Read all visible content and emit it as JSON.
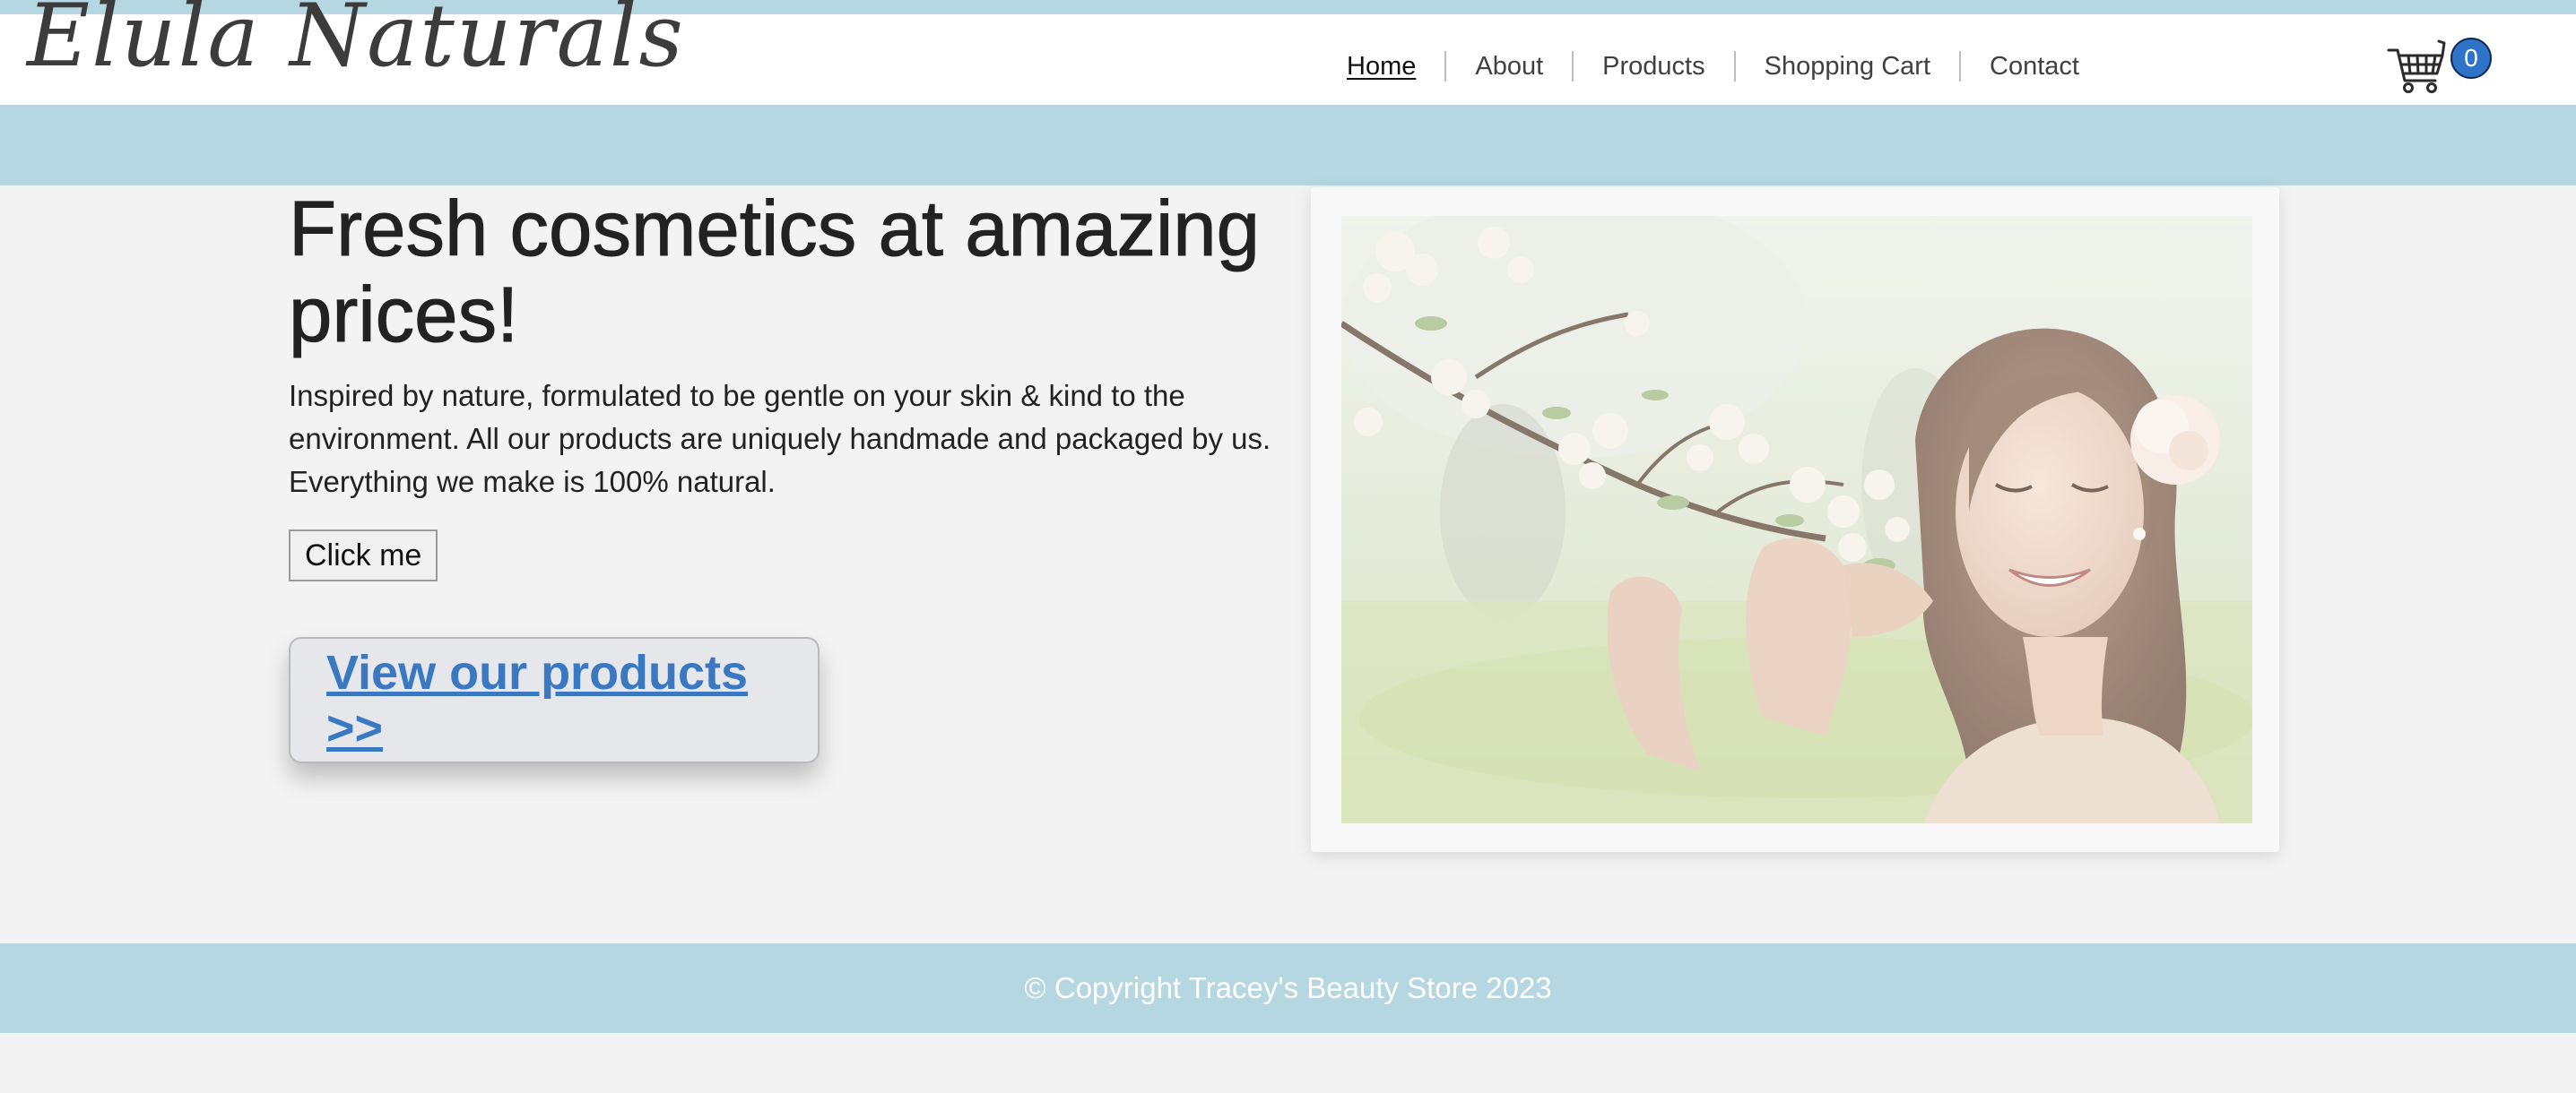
{
  "brand": {
    "logo_text": "Elula Naturals"
  },
  "nav": {
    "items": [
      {
        "label": "Home"
      },
      {
        "label": "About"
      },
      {
        "label": "Products"
      },
      {
        "label": "Shopping Cart"
      },
      {
        "label": "Contact"
      }
    ]
  },
  "cart": {
    "icon": "shopping-cart-icon",
    "count": "0"
  },
  "hero": {
    "title": "Fresh cosmetics at amazing prices!",
    "description": "Inspired by nature, formulated to be gentle on your skin & kind to the environment. All our products are uniquely handmade and packaged by us. Everything we make is 100% natural.",
    "button_label": "Click me",
    "products_link": "View our products >>"
  },
  "footer": {
    "copyright": "© Copyright Tracey's Beauty Store 2023"
  },
  "colors": {
    "accent_bar": "#b5d7e2",
    "link": "#3a78c1",
    "badge": "#2f73c8",
    "page_background": "#f3f3f3"
  }
}
